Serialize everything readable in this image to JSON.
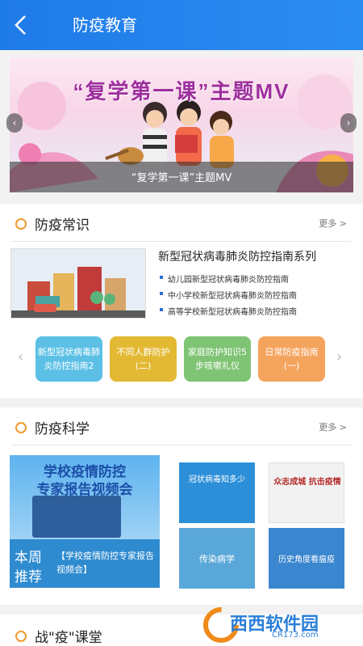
{
  "header": {
    "title": "防疫教育"
  },
  "banner": {
    "headline": "“复学第一课”主题MV",
    "caption": "“复学第一课”主题MV"
  },
  "section1": {
    "title": "防疫常识",
    "more": "更多 >",
    "card_title": "新型冠状病毒肺炎防控指南系列",
    "bullets": [
      "幼儿园新型冠状病毒肺炎防控指南",
      "中小学校新型冠状病毒肺炎防控指南",
      "高等学校新型冠状病毒肺炎防控指南"
    ],
    "chips": [
      {
        "line1": "新型冠状病毒肺",
        "line2": "炎防控指南2",
        "color": "#5cc0e6"
      },
      {
        "line1": "不同人群防护",
        "line2": "(二)",
        "color": "#e3b934"
      },
      {
        "line1": "家庭防护知识5",
        "line2": "步咳嗽礼仪",
        "color": "#7fc474"
      },
      {
        "line1": "日常防疫指南",
        "line2": "(一)",
        "color": "#f5a45e"
      }
    ]
  },
  "section2": {
    "title": "防疫科学",
    "more": "更多 >",
    "big_headline1": "学校疫情防控",
    "big_headline2": "专家报告视频会",
    "big_tag1": "本周",
    "big_tag2": "推荐",
    "big_caption": "【学校疫情防控专家报告视频会】",
    "thumbs": [
      {
        "text": "冠状病毒知多少",
        "color": "#2c8fd8"
      },
      {
        "text": "众志成城 抗击疫情",
        "color": "#f2f2f2"
      },
      {
        "text": "传染病学",
        "color": "#5aa7d9"
      },
      {
        "text": "历史角度看瘟疫",
        "color": "#3a86cf"
      }
    ]
  },
  "section3": {
    "title": "战\"疫\"课堂"
  },
  "watermark": {
    "text": "西西软件园",
    "sub": "CR173.com"
  }
}
